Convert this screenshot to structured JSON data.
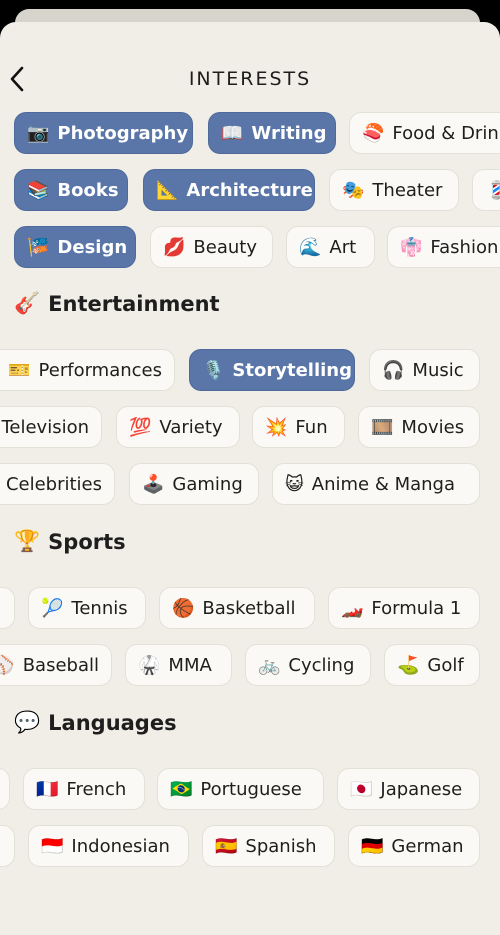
{
  "header": {
    "title": "INTERESTS",
    "back_icon": "chevron-left-icon"
  },
  "colors": {
    "selected": "#5a76a8",
    "chip": "#faf9f5",
    "background": "#f0eee6"
  },
  "sections": [
    {
      "heading": "",
      "rows": [
        [
          {
            "label": "Photography",
            "emoji": "📷",
            "selected": true
          },
          {
            "label": "Writing",
            "emoji": "📖",
            "selected": true
          },
          {
            "label": "Food & Drink",
            "emoji": "🍣",
            "selected": false
          }
        ],
        [
          {
            "label": "Books",
            "emoji": "📚",
            "selected": true
          },
          {
            "label": "Architecture",
            "emoji": "📐",
            "selected": true
          },
          {
            "label": "Theater",
            "emoji": "🎭",
            "selected": false
          },
          {
            "label": "",
            "emoji": "💈",
            "selected": false
          }
        ],
        [
          {
            "label": "Design",
            "emoji": "🎏",
            "selected": true
          },
          {
            "label": "Beauty",
            "emoji": "💋",
            "selected": false
          },
          {
            "label": "Art",
            "emoji": "🌊",
            "selected": false
          },
          {
            "label": "Fashion",
            "emoji": "👘",
            "selected": false
          }
        ]
      ]
    },
    {
      "heading": "Entertainment",
      "icon": "🎸",
      "rows": [
        [
          {
            "label": "Performances",
            "emoji": "🎫",
            "selected": false
          },
          {
            "label": "Storytelling",
            "emoji": "🎙️",
            "selected": true
          },
          {
            "label": "Music",
            "emoji": "🎧",
            "selected": false
          }
        ],
        [
          {
            "label": "Television",
            "emoji": "",
            "selected": false
          },
          {
            "label": "Variety",
            "emoji": "💯",
            "selected": false
          },
          {
            "label": "Fun",
            "emoji": "💥",
            "selected": false
          },
          {
            "label": "Movies",
            "emoji": "🎞️",
            "selected": false
          }
        ],
        [
          {
            "label": "Celebrities",
            "emoji": "",
            "selected": false
          },
          {
            "label": "Gaming",
            "emoji": "🕹️",
            "selected": false
          },
          {
            "label": "Anime & Manga",
            "emoji": "😺",
            "selected": false
          }
        ]
      ]
    },
    {
      "heading": "Sports",
      "icon": "🏆",
      "rows": [
        [
          {
            "label": "",
            "emoji": "",
            "selected": false
          },
          {
            "label": "Tennis",
            "emoji": "🎾",
            "selected": false
          },
          {
            "label": "Basketball",
            "emoji": "🏀",
            "selected": false
          },
          {
            "label": "Formula 1",
            "emoji": "🏎️",
            "selected": false
          }
        ],
        [
          {
            "label": "Baseball",
            "emoji": "⚾",
            "selected": false
          },
          {
            "label": "MMA",
            "emoji": "🥋",
            "selected": false
          },
          {
            "label": "Cycling",
            "emoji": "🚲",
            "selected": false
          },
          {
            "label": "Golf",
            "emoji": "⛳",
            "selected": false
          }
        ]
      ]
    },
    {
      "heading": "Languages",
      "icon": "💬",
      "rows": [
        [
          {
            "label": "",
            "emoji": "",
            "selected": false
          },
          {
            "label": "French",
            "emoji": "🇫🇷",
            "selected": false
          },
          {
            "label": "Portuguese",
            "emoji": "🇧🇷",
            "selected": false
          },
          {
            "label": "Japanese",
            "emoji": "🇯🇵",
            "selected": false
          }
        ],
        [
          {
            "label": "",
            "emoji": "",
            "selected": false
          },
          {
            "label": "Indonesian",
            "emoji": "🇮🇩",
            "selected": false
          },
          {
            "label": "Spanish",
            "emoji": "🇪🇸",
            "selected": false
          },
          {
            "label": "German",
            "emoji": "🇩🇪",
            "selected": false
          }
        ]
      ]
    }
  ]
}
